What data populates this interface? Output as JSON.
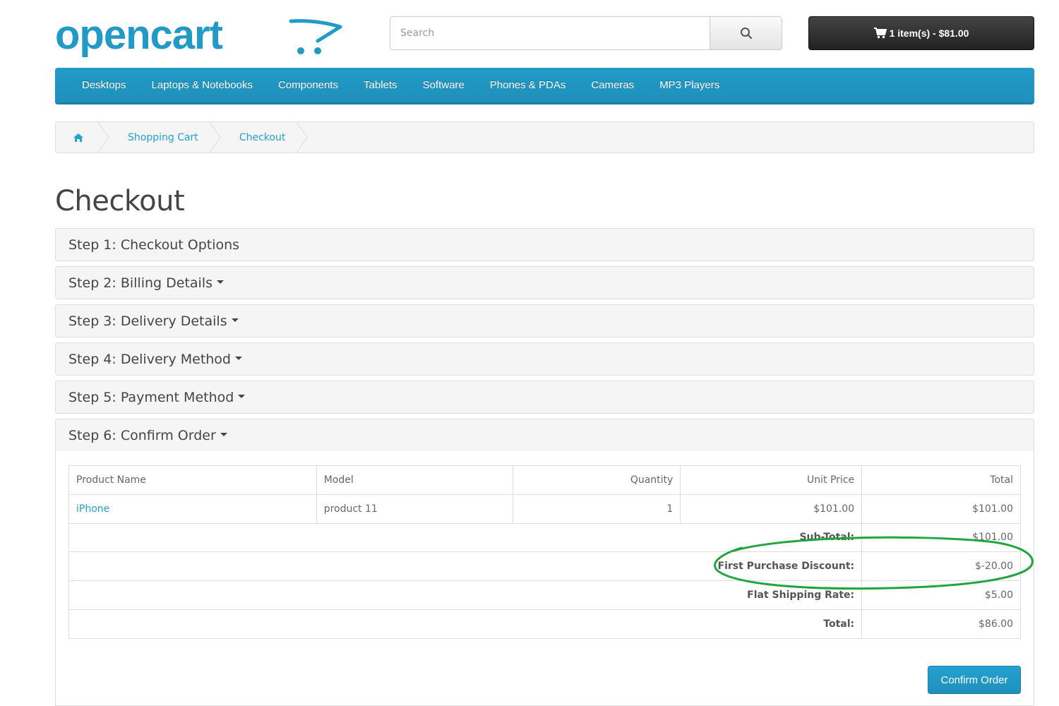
{
  "header": {
    "logo_text": "opencart",
    "search_placeholder": "Search",
    "cart_label": "1 item(s) - $81.00"
  },
  "menu": {
    "items": [
      "Desktops",
      "Laptops & Notebooks",
      "Components",
      "Tablets",
      "Software",
      "Phones & PDAs",
      "Cameras",
      "MP3 Players"
    ]
  },
  "breadcrumb": {
    "items": [
      "Shopping Cart",
      "Checkout"
    ]
  },
  "page": {
    "title": "Checkout"
  },
  "steps": [
    "Step 1: Checkout Options",
    "Step 2: Billing Details",
    "Step 3: Delivery Details",
    "Step 4: Delivery Method",
    "Step 5: Payment Method",
    "Step 6: Confirm Order"
  ],
  "order_table": {
    "headers": [
      "Product Name",
      "Model",
      "Quantity",
      "Unit Price",
      "Total"
    ],
    "rows": [
      {
        "name": "iPhone",
        "model": "product 11",
        "quantity": "1",
        "unit_price": "$101.00",
        "total": "$101.00"
      }
    ],
    "totals": [
      {
        "label": "Sub-Total:",
        "value": "$101.00"
      },
      {
        "label": "First Purchase Discount:",
        "value": "$-20.00"
      },
      {
        "label": "Flat Shipping Rate:",
        "value": "$5.00"
      },
      {
        "label": "Total:",
        "value": "$86.00"
      }
    ]
  },
  "confirm_button": "Confirm Order",
  "colors": {
    "brand_blue": "#229ac8",
    "link_blue": "#23a1d1",
    "highlight_green": "#1fa53c",
    "cart_dark": "#222222"
  },
  "icons": {
    "search": "search-icon",
    "cart": "shopping-cart-icon",
    "home": "home-icon",
    "caret": "caret-down-icon"
  }
}
